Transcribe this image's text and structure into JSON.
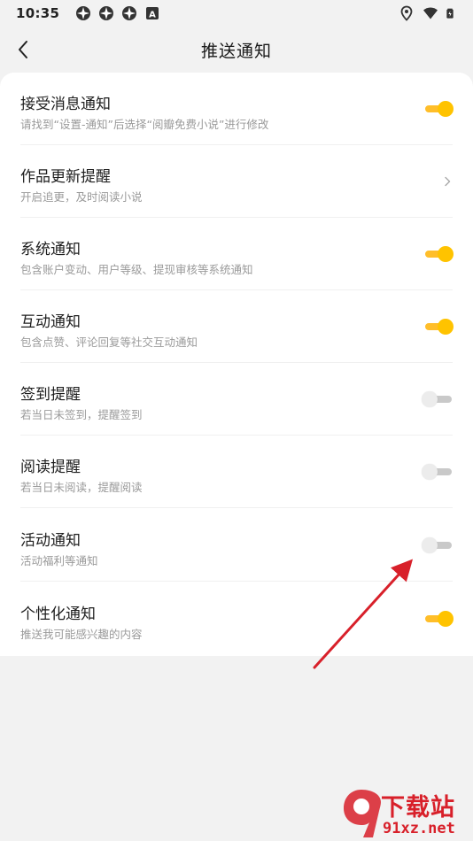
{
  "status_bar": {
    "time": "10:35",
    "left_icons": [
      "app-notification-icon",
      "app-notification-icon",
      "app-notification-icon",
      "a-badge-icon"
    ],
    "right_icons": [
      "location-icon",
      "wifi-icon",
      "battery-icon"
    ],
    "badge_letter": "A"
  },
  "header": {
    "title": "推送通知",
    "back_icon": "chevron-left-icon"
  },
  "colors": {
    "accent": "#ffc300",
    "toggle_off": "#cccccc",
    "arrow": "#d8202a"
  },
  "settings": [
    {
      "title": "接受消息通知",
      "subtitle": "请找到“设置-通知”后选择“阅瓣免费小说”进行修改",
      "control": "toggle",
      "enabled": true
    },
    {
      "title": "作品更新提醒",
      "subtitle": "开启追更，及时阅读小说",
      "control": "chevron",
      "enabled": null
    },
    {
      "title": "系统通知",
      "subtitle": "包含账户变动、用户等级、提现审核等系统通知",
      "control": "toggle",
      "enabled": true
    },
    {
      "title": "互动通知",
      "subtitle": "包含点赞、评论回复等社交互动通知",
      "control": "toggle",
      "enabled": true
    },
    {
      "title": "签到提醒",
      "subtitle": "若当日未签到，提醒签到",
      "control": "toggle",
      "enabled": false
    },
    {
      "title": "阅读提醒",
      "subtitle": "若当日未阅读，提醒阅读",
      "control": "toggle",
      "enabled": false
    },
    {
      "title": "活动通知",
      "subtitle": "活动福利等通知",
      "control": "toggle",
      "enabled": false
    },
    {
      "title": "个性化通知",
      "subtitle": "推送我可能感兴趣的内容",
      "control": "toggle",
      "enabled": true
    }
  ],
  "watermark": {
    "brand": "下载站",
    "url": "91xz.net",
    "logo_text": "9"
  }
}
